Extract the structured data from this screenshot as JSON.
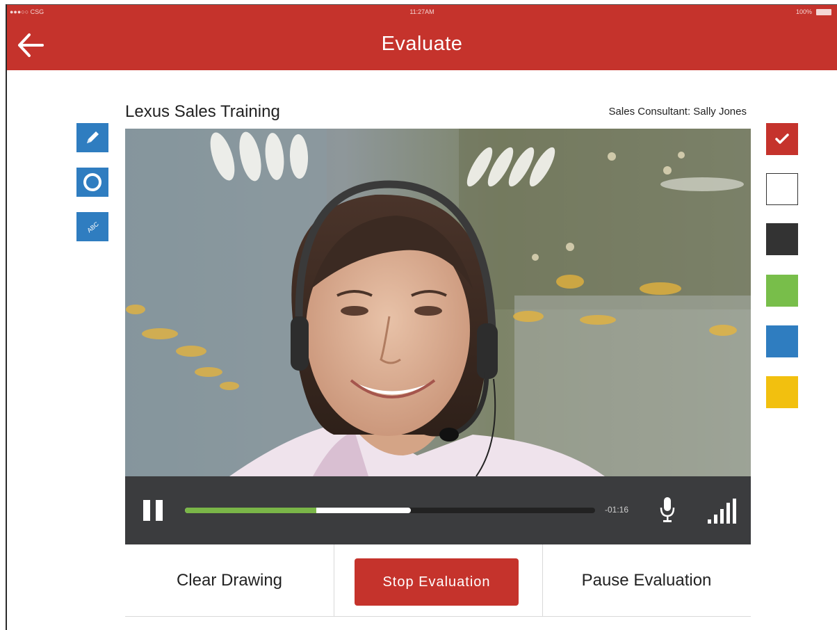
{
  "status_bar": {
    "carrier": "●●●○○ CSG",
    "time": "11:27AM",
    "battery": "100%"
  },
  "header": {
    "title": "Evaluate",
    "back_icon": "arrow-left-icon",
    "brand_color": "#c5332c"
  },
  "session": {
    "title": "Lexus Sales Training",
    "consultant": "Sales Consultant: Sally Jones"
  },
  "tools": [
    {
      "name": "pencil-icon"
    },
    {
      "name": "circle-icon"
    },
    {
      "name": "text-abc-icon",
      "glyph": "ABC"
    }
  ],
  "colors": [
    {
      "name": "red",
      "hex": "#c5332c",
      "selected": true
    },
    {
      "name": "white",
      "hex": "#ffffff",
      "selected": false
    },
    {
      "name": "black",
      "hex": "#333333",
      "selected": false
    },
    {
      "name": "green",
      "hex": "#78be4a",
      "selected": false
    },
    {
      "name": "blue",
      "hex": "#2f7dc0",
      "selected": false
    },
    {
      "name": "yellow",
      "hex": "#f2c00f",
      "selected": false
    }
  ],
  "player": {
    "state": "playing",
    "pause_icon": "pause-icon",
    "played_fraction": 0.32,
    "buffered_fraction": 0.55,
    "time_remaining": "-01:16",
    "mic_icon": "microphone-icon",
    "signal_icon": "signal-bars-icon",
    "progress_color": "#7ab648"
  },
  "actions": {
    "clear": "Clear Drawing",
    "stop": "Stop Evaluation",
    "pause": "Pause Evaluation"
  }
}
